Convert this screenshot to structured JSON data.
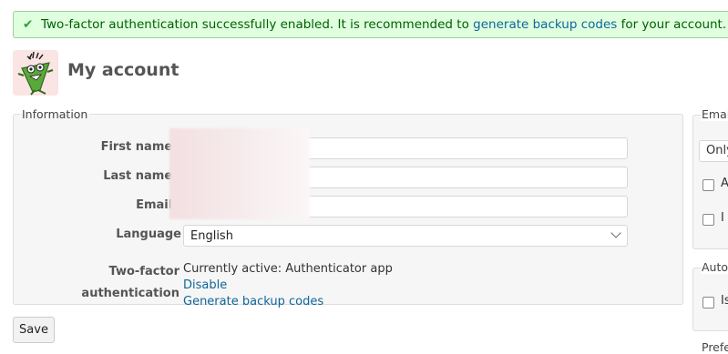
{
  "flash": {
    "icon": "check-icon",
    "text_before": "Two-factor authentication successfully enabled. It is recommended to ",
    "link": "generate backup codes",
    "text_after": " for your account."
  },
  "header": {
    "avatar_icon": "user-avatar",
    "title": "My account"
  },
  "information": {
    "legend": "Information",
    "first_name_label": "First name",
    "last_name_label": "Last name",
    "email_label": "Email",
    "required_mark": "*",
    "language_label": "Language",
    "language_value": "English",
    "twofa_label_line1": "Two-factor",
    "twofa_label_line2": "authentication",
    "twofa_status": "Currently active: Authenticator app",
    "twofa_disable": "Disable",
    "twofa_backup": "Generate backup codes"
  },
  "actions": {
    "save_label": "Save"
  },
  "sidebar": {
    "email_legend": "Emai",
    "email_select_value": "Only",
    "email_checkbox_1": "A",
    "email_checkbox_2": "I",
    "auto_legend": "Auto",
    "auto_checkbox_1": "Is",
    "pref_legend": "Prefe"
  },
  "colors": {
    "flash_bg": "#dfffdf",
    "flash_border": "#9fcf9f",
    "link": "#116699",
    "required": "#bb0000"
  }
}
